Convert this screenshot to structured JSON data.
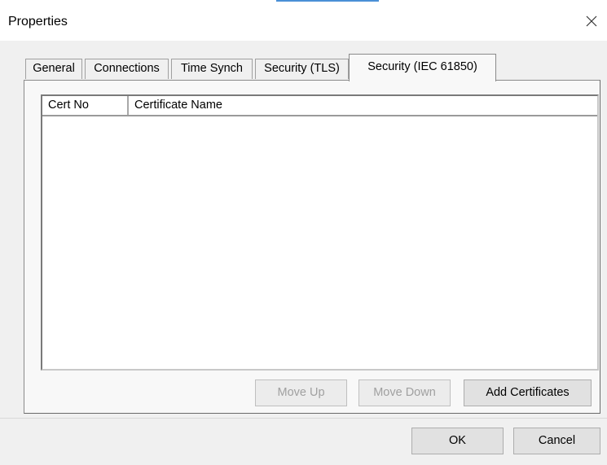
{
  "window": {
    "title": "Properties",
    "close_icon": "close-icon"
  },
  "tabs": [
    {
      "label": "General",
      "active": false
    },
    {
      "label": "Connections",
      "active": false
    },
    {
      "label": "Time Synch",
      "active": false
    },
    {
      "label": "Security (TLS)",
      "active": false
    },
    {
      "label": "Security (IEC 61850)",
      "active": true
    }
  ],
  "certificates_list": {
    "columns": [
      "Cert No",
      "Certificate Name"
    ],
    "rows": []
  },
  "panel_buttons": {
    "move_up": {
      "label": "Move Up",
      "enabled": false
    },
    "move_down": {
      "label": "Move Down",
      "enabled": false
    },
    "add_certificates": {
      "label": "Add Certificates",
      "enabled": true
    }
  },
  "dialog_buttons": {
    "ok": "OK",
    "cancel": "Cancel"
  }
}
